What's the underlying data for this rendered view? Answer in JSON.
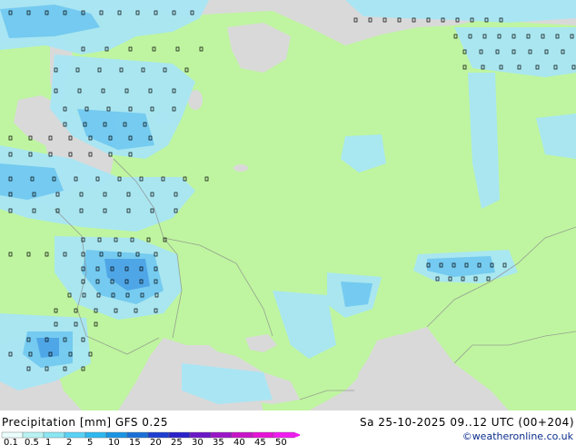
{
  "footer": {
    "title": "Precipitation [mm]  GFS 0.25",
    "datetime": "Sa 25-10-2025 09..12 UTC (00+204)",
    "credit": "©weatheronline.co.uk"
  },
  "legend": {
    "labels": [
      "0.1",
      "0.5",
      "1",
      "2",
      "5",
      "10",
      "15",
      "20",
      "25",
      "30",
      "35",
      "40",
      "45",
      "50"
    ],
    "colors": [
      "#eafffc",
      "#b8f2f2",
      "#8ae6f2",
      "#5ad2f5",
      "#2fb7ef",
      "#1c94e3",
      "#1c6fd6",
      "#1d3fcf",
      "#2a22c8",
      "#6a18c6",
      "#9a16c8",
      "#c814c8",
      "#e414d6",
      "#f01cf0"
    ]
  },
  "map": {
    "colors": {
      "sea": "#d9d9d9",
      "land": "#bff5a0",
      "light_precip": "#a8e6f5",
      "medium_precip": "#6fc8f0",
      "heavy_precip": "#4fa6e6",
      "dots": "#000000"
    }
  }
}
